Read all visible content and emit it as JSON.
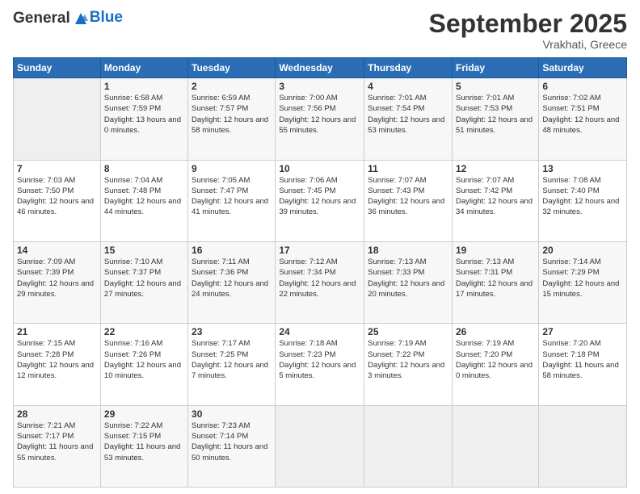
{
  "header": {
    "logo_line1": "General",
    "logo_line2": "Blue",
    "month_title": "September 2025",
    "location": "Vrakhati, Greece"
  },
  "weekdays": [
    "Sunday",
    "Monday",
    "Tuesday",
    "Wednesday",
    "Thursday",
    "Friday",
    "Saturday"
  ],
  "weeks": [
    [
      {
        "day": "",
        "sunrise": "",
        "sunset": "",
        "daylight": ""
      },
      {
        "day": "1",
        "sunrise": "Sunrise: 6:58 AM",
        "sunset": "Sunset: 7:59 PM",
        "daylight": "Daylight: 13 hours and 0 minutes."
      },
      {
        "day": "2",
        "sunrise": "Sunrise: 6:59 AM",
        "sunset": "Sunset: 7:57 PM",
        "daylight": "Daylight: 12 hours and 58 minutes."
      },
      {
        "day": "3",
        "sunrise": "Sunrise: 7:00 AM",
        "sunset": "Sunset: 7:56 PM",
        "daylight": "Daylight: 12 hours and 55 minutes."
      },
      {
        "day": "4",
        "sunrise": "Sunrise: 7:01 AM",
        "sunset": "Sunset: 7:54 PM",
        "daylight": "Daylight: 12 hours and 53 minutes."
      },
      {
        "day": "5",
        "sunrise": "Sunrise: 7:01 AM",
        "sunset": "Sunset: 7:53 PM",
        "daylight": "Daylight: 12 hours and 51 minutes."
      },
      {
        "day": "6",
        "sunrise": "Sunrise: 7:02 AM",
        "sunset": "Sunset: 7:51 PM",
        "daylight": "Daylight: 12 hours and 48 minutes."
      }
    ],
    [
      {
        "day": "7",
        "sunrise": "Sunrise: 7:03 AM",
        "sunset": "Sunset: 7:50 PM",
        "daylight": "Daylight: 12 hours and 46 minutes."
      },
      {
        "day": "8",
        "sunrise": "Sunrise: 7:04 AM",
        "sunset": "Sunset: 7:48 PM",
        "daylight": "Daylight: 12 hours and 44 minutes."
      },
      {
        "day": "9",
        "sunrise": "Sunrise: 7:05 AM",
        "sunset": "Sunset: 7:47 PM",
        "daylight": "Daylight: 12 hours and 41 minutes."
      },
      {
        "day": "10",
        "sunrise": "Sunrise: 7:06 AM",
        "sunset": "Sunset: 7:45 PM",
        "daylight": "Daylight: 12 hours and 39 minutes."
      },
      {
        "day": "11",
        "sunrise": "Sunrise: 7:07 AM",
        "sunset": "Sunset: 7:43 PM",
        "daylight": "Daylight: 12 hours and 36 minutes."
      },
      {
        "day": "12",
        "sunrise": "Sunrise: 7:07 AM",
        "sunset": "Sunset: 7:42 PM",
        "daylight": "Daylight: 12 hours and 34 minutes."
      },
      {
        "day": "13",
        "sunrise": "Sunrise: 7:08 AM",
        "sunset": "Sunset: 7:40 PM",
        "daylight": "Daylight: 12 hours and 32 minutes."
      }
    ],
    [
      {
        "day": "14",
        "sunrise": "Sunrise: 7:09 AM",
        "sunset": "Sunset: 7:39 PM",
        "daylight": "Daylight: 12 hours and 29 minutes."
      },
      {
        "day": "15",
        "sunrise": "Sunrise: 7:10 AM",
        "sunset": "Sunset: 7:37 PM",
        "daylight": "Daylight: 12 hours and 27 minutes."
      },
      {
        "day": "16",
        "sunrise": "Sunrise: 7:11 AM",
        "sunset": "Sunset: 7:36 PM",
        "daylight": "Daylight: 12 hours and 24 minutes."
      },
      {
        "day": "17",
        "sunrise": "Sunrise: 7:12 AM",
        "sunset": "Sunset: 7:34 PM",
        "daylight": "Daylight: 12 hours and 22 minutes."
      },
      {
        "day": "18",
        "sunrise": "Sunrise: 7:13 AM",
        "sunset": "Sunset: 7:33 PM",
        "daylight": "Daylight: 12 hours and 20 minutes."
      },
      {
        "day": "19",
        "sunrise": "Sunrise: 7:13 AM",
        "sunset": "Sunset: 7:31 PM",
        "daylight": "Daylight: 12 hours and 17 minutes."
      },
      {
        "day": "20",
        "sunrise": "Sunrise: 7:14 AM",
        "sunset": "Sunset: 7:29 PM",
        "daylight": "Daylight: 12 hours and 15 minutes."
      }
    ],
    [
      {
        "day": "21",
        "sunrise": "Sunrise: 7:15 AM",
        "sunset": "Sunset: 7:28 PM",
        "daylight": "Daylight: 12 hours and 12 minutes."
      },
      {
        "day": "22",
        "sunrise": "Sunrise: 7:16 AM",
        "sunset": "Sunset: 7:26 PM",
        "daylight": "Daylight: 12 hours and 10 minutes."
      },
      {
        "day": "23",
        "sunrise": "Sunrise: 7:17 AM",
        "sunset": "Sunset: 7:25 PM",
        "daylight": "Daylight: 12 hours and 7 minutes."
      },
      {
        "day": "24",
        "sunrise": "Sunrise: 7:18 AM",
        "sunset": "Sunset: 7:23 PM",
        "daylight": "Daylight: 12 hours and 5 minutes."
      },
      {
        "day": "25",
        "sunrise": "Sunrise: 7:19 AM",
        "sunset": "Sunset: 7:22 PM",
        "daylight": "Daylight: 12 hours and 3 minutes."
      },
      {
        "day": "26",
        "sunrise": "Sunrise: 7:19 AM",
        "sunset": "Sunset: 7:20 PM",
        "daylight": "Daylight: 12 hours and 0 minutes."
      },
      {
        "day": "27",
        "sunrise": "Sunrise: 7:20 AM",
        "sunset": "Sunset: 7:18 PM",
        "daylight": "Daylight: 11 hours and 58 minutes."
      }
    ],
    [
      {
        "day": "28",
        "sunrise": "Sunrise: 7:21 AM",
        "sunset": "Sunset: 7:17 PM",
        "daylight": "Daylight: 11 hours and 55 minutes."
      },
      {
        "day": "29",
        "sunrise": "Sunrise: 7:22 AM",
        "sunset": "Sunset: 7:15 PM",
        "daylight": "Daylight: 11 hours and 53 minutes."
      },
      {
        "day": "30",
        "sunrise": "Sunrise: 7:23 AM",
        "sunset": "Sunset: 7:14 PM",
        "daylight": "Daylight: 11 hours and 50 minutes."
      },
      {
        "day": "",
        "sunrise": "",
        "sunset": "",
        "daylight": ""
      },
      {
        "day": "",
        "sunrise": "",
        "sunset": "",
        "daylight": ""
      },
      {
        "day": "",
        "sunrise": "",
        "sunset": "",
        "daylight": ""
      },
      {
        "day": "",
        "sunrise": "",
        "sunset": "",
        "daylight": ""
      }
    ]
  ]
}
